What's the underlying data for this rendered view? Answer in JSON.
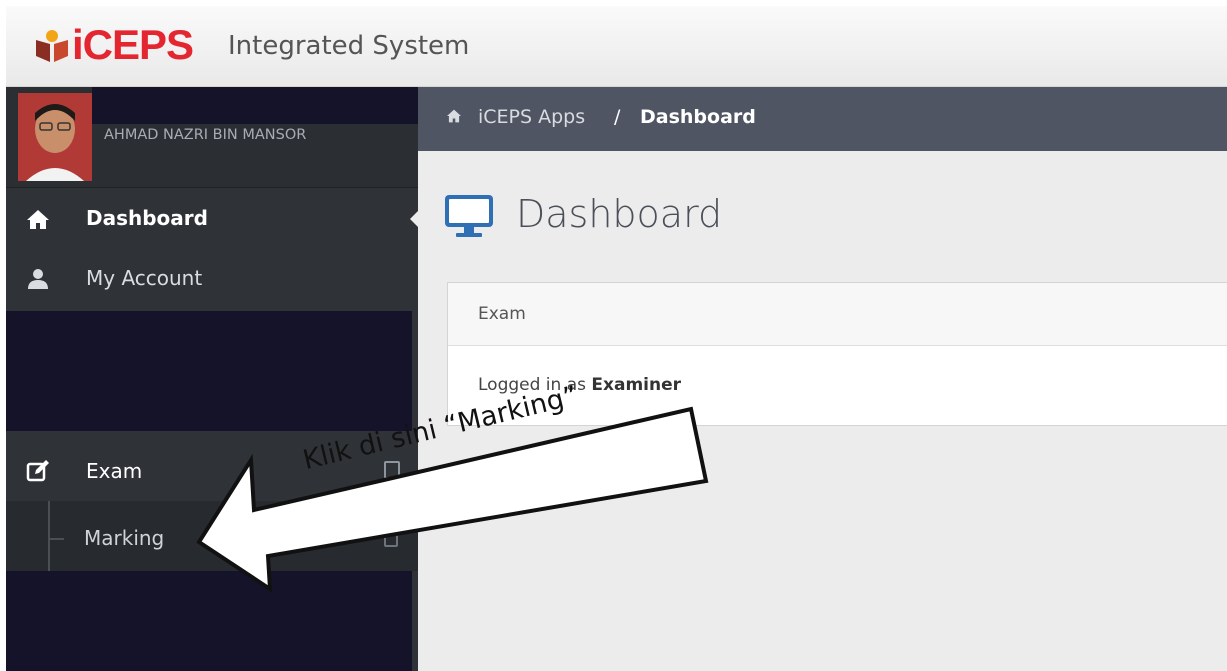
{
  "app": {
    "logo_text": "iCEPS",
    "logo_subtitle": "Integrated System"
  },
  "sidebar": {
    "user_name": "AHMAD NAZRI BIN MANSOR",
    "items": [
      {
        "label": "Dashboard",
        "icon": "home-icon",
        "active": true
      },
      {
        "label": "My Account",
        "icon": "user-icon"
      },
      {
        "label": "Exam",
        "icon": "edit-icon"
      }
    ],
    "sub_items": [
      {
        "label": "Marking"
      }
    ]
  },
  "breadcrumb": {
    "home_icon": "home-icon",
    "link": "iCEPS Apps",
    "separator": "/",
    "current": "Dashboard"
  },
  "main": {
    "title": "Dashboard",
    "title_icon": "monitor-icon",
    "panel": {
      "header": "Exam",
      "body_prefix": "Logged in as ",
      "body_role": "Examiner"
    }
  },
  "annotation": {
    "text": "Klik di sini “Marking”"
  },
  "colors": {
    "brand_red": "#e3262f",
    "sidebar_bg": "#2f3338",
    "breadcrumb_bg": "#4f5563",
    "icon_blue": "#2f6fb4"
  }
}
